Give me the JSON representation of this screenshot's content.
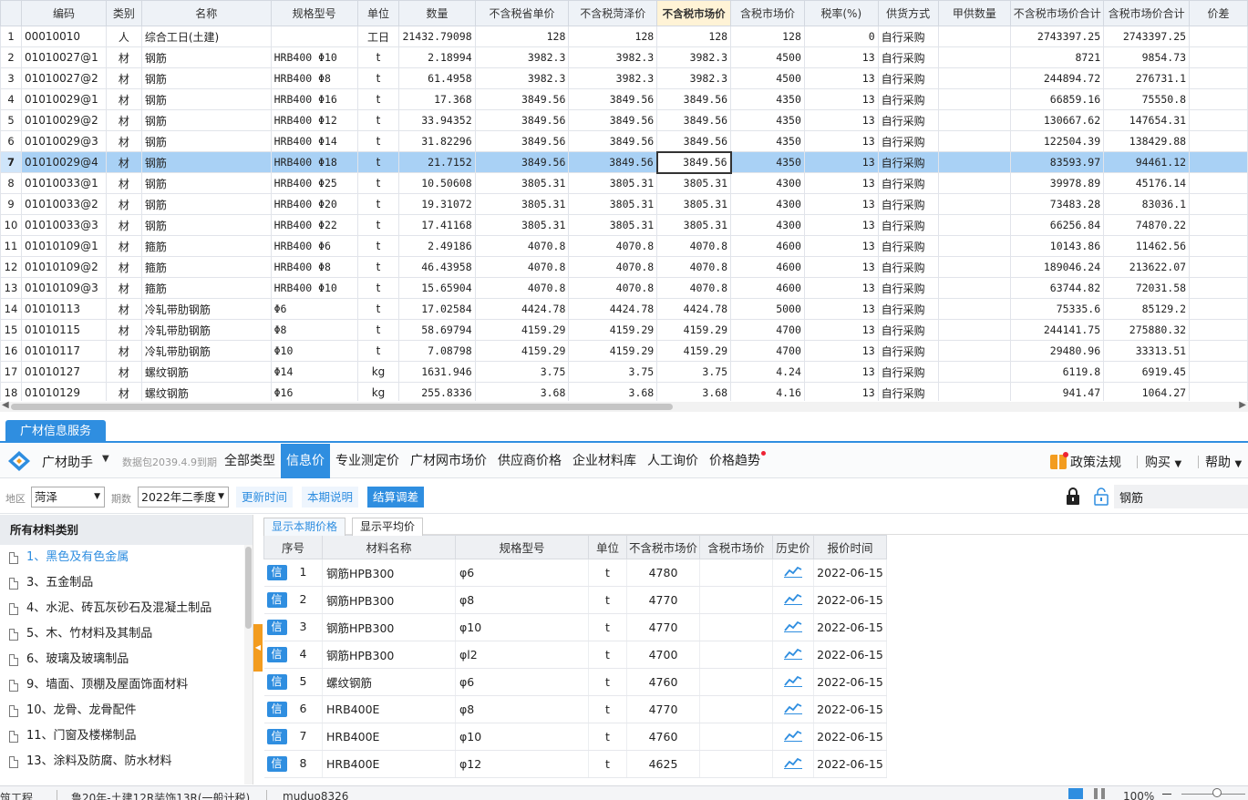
{
  "grid": {
    "columns": [
      "编码",
      "类别",
      "名称",
      "规格型号",
      "单位",
      "数量",
      "不含税省单价",
      "不含税菏泽价",
      "不含税市场价",
      "含税市场价",
      "税率(%)",
      "供货方式",
      "甲供数量",
      "不含税市场价合计",
      "含税市场价合计",
      "价差"
    ],
    "rows": [
      {
        "n": "1",
        "code": "00010010",
        "cat": "人",
        "name": "综合工日(土建)",
        "spec": "",
        "unit": "工日",
        "qty": "21432.79098",
        "p1": "128",
        "p2": "128",
        "p3": "128",
        "p4": "128",
        "tax": "0",
        "supply": "自行采购",
        "jia": "",
        "t1": "2743397.25",
        "t2": "2743397.25",
        "diff": ""
      },
      {
        "n": "2",
        "code": "01010027@1",
        "cat": "材",
        "name": "钢筋",
        "spec": "HRB400 Φ10",
        "unit": "t",
        "qty": "2.18994",
        "p1": "3982.3",
        "p2": "3982.3",
        "p3": "3982.3",
        "p4": "4500",
        "tax": "13",
        "supply": "自行采购",
        "jia": "",
        "t1": "8721",
        "t2": "9854.73",
        "diff": ""
      },
      {
        "n": "3",
        "code": "01010027@2",
        "cat": "材",
        "name": "钢筋",
        "spec": "HRB400 Φ8",
        "unit": "t",
        "qty": "61.4958",
        "p1": "3982.3",
        "p2": "3982.3",
        "p3": "3982.3",
        "p4": "4500",
        "tax": "13",
        "supply": "自行采购",
        "jia": "",
        "t1": "244894.72",
        "t2": "276731.1",
        "diff": ""
      },
      {
        "n": "4",
        "code": "01010029@1",
        "cat": "材",
        "name": "钢筋",
        "spec": "HRB400 Φ16",
        "unit": "t",
        "qty": "17.368",
        "p1": "3849.56",
        "p2": "3849.56",
        "p3": "3849.56",
        "p4": "4350",
        "tax": "13",
        "supply": "自行采购",
        "jia": "",
        "t1": "66859.16",
        "t2": "75550.8",
        "diff": ""
      },
      {
        "n": "5",
        "code": "01010029@2",
        "cat": "材",
        "name": "钢筋",
        "spec": "HRB400 Φ12",
        "unit": "t",
        "qty": "33.94352",
        "p1": "3849.56",
        "p2": "3849.56",
        "p3": "3849.56",
        "p4": "4350",
        "tax": "13",
        "supply": "自行采购",
        "jia": "",
        "t1": "130667.62",
        "t2": "147654.31",
        "diff": ""
      },
      {
        "n": "6",
        "code": "01010029@3",
        "cat": "材",
        "name": "钢筋",
        "spec": "HRB400 Φ14",
        "unit": "t",
        "qty": "31.82296",
        "p1": "3849.56",
        "p2": "3849.56",
        "p3": "3849.56",
        "p4": "4350",
        "tax": "13",
        "supply": "自行采购",
        "jia": "",
        "t1": "122504.39",
        "t2": "138429.88",
        "diff": ""
      },
      {
        "n": "7",
        "code": "01010029@4",
        "cat": "材",
        "name": "钢筋",
        "spec": "HRB400 Φ18",
        "unit": "t",
        "qty": "21.7152",
        "p1": "3849.56",
        "p2": "3849.56",
        "p3": "3849.56",
        "p4": "4350",
        "tax": "13",
        "supply": "自行采购",
        "jia": "",
        "t1": "83593.97",
        "t2": "94461.12",
        "diff": ""
      },
      {
        "n": "8",
        "code": "01010033@1",
        "cat": "材",
        "name": "钢筋",
        "spec": "HRB400 Φ25",
        "unit": "t",
        "qty": "10.50608",
        "p1": "3805.31",
        "p2": "3805.31",
        "p3": "3805.31",
        "p4": "4300",
        "tax": "13",
        "supply": "自行采购",
        "jia": "",
        "t1": "39978.89",
        "t2": "45176.14",
        "diff": ""
      },
      {
        "n": "9",
        "code": "01010033@2",
        "cat": "材",
        "name": "钢筋",
        "spec": "HRB400 Φ20",
        "unit": "t",
        "qty": "19.31072",
        "p1": "3805.31",
        "p2": "3805.31",
        "p3": "3805.31",
        "p4": "4300",
        "tax": "13",
        "supply": "自行采购",
        "jia": "",
        "t1": "73483.28",
        "t2": "83036.1",
        "diff": ""
      },
      {
        "n": "10",
        "code": "01010033@3",
        "cat": "材",
        "name": "钢筋",
        "spec": "HRB400 Φ22",
        "unit": "t",
        "qty": "17.41168",
        "p1": "3805.31",
        "p2": "3805.31",
        "p3": "3805.31",
        "p4": "4300",
        "tax": "13",
        "supply": "自行采购",
        "jia": "",
        "t1": "66256.84",
        "t2": "74870.22",
        "diff": ""
      },
      {
        "n": "11",
        "code": "01010109@1",
        "cat": "材",
        "name": "箍筋",
        "spec": "HRB400 Φ6",
        "unit": "t",
        "qty": "2.49186",
        "p1": "4070.8",
        "p2": "4070.8",
        "p3": "4070.8",
        "p4": "4600",
        "tax": "13",
        "supply": "自行采购",
        "jia": "",
        "t1": "10143.86",
        "t2": "11462.56",
        "diff": ""
      },
      {
        "n": "12",
        "code": "01010109@2",
        "cat": "材",
        "name": "箍筋",
        "spec": "HRB400 Φ8",
        "unit": "t",
        "qty": "46.43958",
        "p1": "4070.8",
        "p2": "4070.8",
        "p3": "4070.8",
        "p4": "4600",
        "tax": "13",
        "supply": "自行采购",
        "jia": "",
        "t1": "189046.24",
        "t2": "213622.07",
        "diff": ""
      },
      {
        "n": "13",
        "code": "01010109@3",
        "cat": "材",
        "name": "箍筋",
        "spec": "HRB400 Φ10",
        "unit": "t",
        "qty": "15.65904",
        "p1": "4070.8",
        "p2": "4070.8",
        "p3": "4070.8",
        "p4": "4600",
        "tax": "13",
        "supply": "自行采购",
        "jia": "",
        "t1": "63744.82",
        "t2": "72031.58",
        "diff": ""
      },
      {
        "n": "14",
        "code": "01010113",
        "cat": "材",
        "name": "冷轧带肋钢筋",
        "spec": "Φ6",
        "unit": "t",
        "qty": "17.02584",
        "p1": "4424.78",
        "p2": "4424.78",
        "p3": "4424.78",
        "p4": "5000",
        "tax": "13",
        "supply": "自行采购",
        "jia": "",
        "t1": "75335.6",
        "t2": "85129.2",
        "diff": ""
      },
      {
        "n": "15",
        "code": "01010115",
        "cat": "材",
        "name": "冷轧带肋钢筋",
        "spec": "Φ8",
        "unit": "t",
        "qty": "58.69794",
        "p1": "4159.29",
        "p2": "4159.29",
        "p3": "4159.29",
        "p4": "4700",
        "tax": "13",
        "supply": "自行采购",
        "jia": "",
        "t1": "244141.75",
        "t2": "275880.32",
        "diff": ""
      },
      {
        "n": "16",
        "code": "01010117",
        "cat": "材",
        "name": "冷轧带肋钢筋",
        "spec": "Φ10",
        "unit": "t",
        "qty": "7.08798",
        "p1": "4159.29",
        "p2": "4159.29",
        "p3": "4159.29",
        "p4": "4700",
        "tax": "13",
        "supply": "自行采购",
        "jia": "",
        "t1": "29480.96",
        "t2": "33313.51",
        "diff": ""
      },
      {
        "n": "17",
        "code": "01010127",
        "cat": "材",
        "name": "螺纹钢筋",
        "spec": "Φ14",
        "unit": "kg",
        "qty": "1631.946",
        "p1": "3.75",
        "p2": "3.75",
        "p3": "3.75",
        "p4": "4.24",
        "tax": "13",
        "supply": "自行采购",
        "jia": "",
        "t1": "6119.8",
        "t2": "6919.45",
        "diff": ""
      },
      {
        "n": "18",
        "code": "01010129",
        "cat": "材",
        "name": "螺纹钢筋",
        "spec": "Φ16",
        "unit": "kg",
        "qty": "255.8336",
        "p1": "3.68",
        "p2": "3.68",
        "p3": "3.68",
        "p4": "4.16",
        "tax": "13",
        "supply": "自行采购",
        "jia": "",
        "t1": "941.47",
        "t2": "1064.27",
        "diff": ""
      }
    ]
  },
  "panel_tab": "广材信息服务",
  "toolbar": {
    "app_name": "广材助手",
    "pkg_note": "数据包2039.4.9到期",
    "nav": [
      "全部类型",
      "信息价",
      "专业测定价",
      "广材网市场价",
      "供应商价格",
      "企业材料库",
      "人工询价",
      "价格趋势"
    ],
    "policy": "政策法规",
    "buy": "购买",
    "help": "帮助"
  },
  "filters": {
    "region_label": "地区",
    "region": "菏泽",
    "period_label": "期数",
    "period": "2022年二季度",
    "update_btn": "更新时间",
    "desc_btn": "本期说明",
    "calc_btn": "结算调差",
    "search_value": "钢筋"
  },
  "categories": {
    "header": "所有材料类别",
    "items": [
      "1、黑色及有色金属",
      "3、五金制品",
      "4、水泥、砖瓦灰砂石及混凝土制品",
      "5、木、竹材料及其制品",
      "6、玻璃及玻璃制品",
      "9、墙面、顶棚及屋面饰面材料",
      "10、龙骨、龙骨配件",
      "11、门窗及楼梯制品",
      "13、涂料及防腐、防水材料"
    ]
  },
  "price": {
    "tab_current": "显示本期价格",
    "tab_avg": "显示平均价",
    "columns": [
      "序号",
      "材料名称",
      "规格型号",
      "单位",
      "不含税市场价",
      "含税市场价",
      "历史价",
      "报价时间"
    ],
    "badge": "信",
    "rows": [
      {
        "n": "1",
        "name": "钢筋HPB300",
        "spec": "φ6",
        "unit": "t",
        "price": "4780",
        "tax_price": "",
        "date": "2022-06-15"
      },
      {
        "n": "2",
        "name": "钢筋HPB300",
        "spec": "φ8",
        "unit": "t",
        "price": "4770",
        "tax_price": "",
        "date": "2022-06-15"
      },
      {
        "n": "3",
        "name": "钢筋HPB300",
        "spec": "φ10",
        "unit": "t",
        "price": "4770",
        "tax_price": "",
        "date": "2022-06-15"
      },
      {
        "n": "4",
        "name": "钢筋HPB300",
        "spec": "φl2",
        "unit": "t",
        "price": "4700",
        "tax_price": "",
        "date": "2022-06-15"
      },
      {
        "n": "5",
        "name": "螺纹钢筋",
        "spec": "φ6",
        "unit": "t",
        "price": "4760",
        "tax_price": "",
        "date": "2022-06-15"
      },
      {
        "n": "6",
        "name": "HRB400E",
        "spec": "φ8",
        "unit": "t",
        "price": "4770",
        "tax_price": "",
        "date": "2022-06-15"
      },
      {
        "n": "7",
        "name": "HRB400E",
        "spec": "φ10",
        "unit": "t",
        "price": "4760",
        "tax_price": "",
        "date": "2022-06-15"
      },
      {
        "n": "8",
        "name": "HRB400E",
        "spec": "φ12",
        "unit": "t",
        "price": "4625",
        "tax_price": "",
        "date": "2022-06-15"
      }
    ]
  },
  "status": {
    "left": "筑工程",
    "mid": "鲁20年-土建12R装饰13R(一般计税)",
    "user": "muduo8326",
    "zoom": "100%"
  },
  "colors": {
    "accent": "#2f8ee0",
    "highlight_row": "#a9d1f5",
    "orange": "#f39c1f"
  }
}
